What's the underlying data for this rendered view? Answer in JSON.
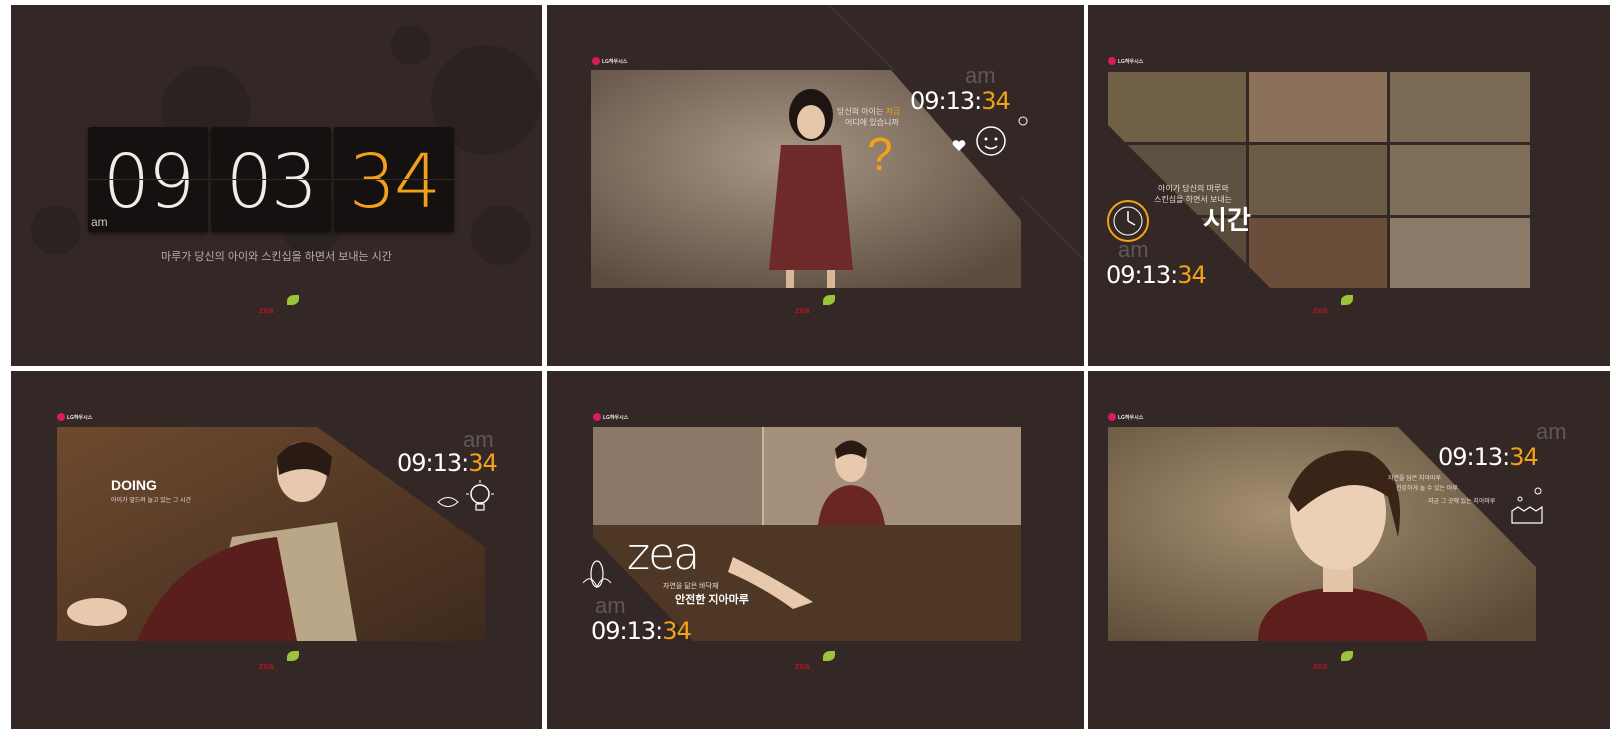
{
  "colors": {
    "panel_bg": "#332826",
    "accent": "#f2a119",
    "text": "#ffffff",
    "brand_red": "#b0141f",
    "logo_pink": "#d91a5b",
    "leaf_green": "#9bc43a"
  },
  "panel1": {
    "hours": "09",
    "minutes": "03",
    "seconds": "34",
    "ampm": "am",
    "caption": "마루가 당신의 아이와 스킨십을 하면서 보내는 시간",
    "brand": "zea"
  },
  "panel2": {
    "logo": "LG하우시스",
    "ampm": "am",
    "clock_hm": "09:13:",
    "clock_s": "34",
    "question_line1_a": "당신의 아이는 ",
    "question_line1_b": "지금",
    "question_line2": "어디에 있습니까",
    "question_mark": "?",
    "icons": [
      "child-face-icon",
      "heart-icon",
      "flower-icon"
    ],
    "brand": "zea"
  },
  "panel3": {
    "logo": "LG하우시스",
    "ampm": "am",
    "clock_hm": "09:13:",
    "clock_s": "34",
    "sub_line1": "아이가 당신의 마루와",
    "sub_line2": "스킨십을 하면서 보내는",
    "headline": "시간",
    "icons": [
      "clock-icon"
    ],
    "brand": "zea"
  },
  "panel4": {
    "logo": "LG하우시스",
    "ampm": "am",
    "clock_hm": "09:13:",
    "clock_s": "34",
    "headline": "DOING",
    "sub": "아이가 엎드려 놀고 있는 그 시간",
    "icons": [
      "lightbulb-icon",
      "leaf-icon"
    ],
    "brand": "zea"
  },
  "panel5": {
    "logo": "LG하우시스",
    "ampm": "am",
    "clock_hm": "09:13:",
    "clock_s": "34",
    "brand_big": "zea",
    "sub_line1": "자연을 닮은 바닥재",
    "headline": "안전한 지아마루",
    "icons": [
      "corn-icon"
    ],
    "brand": "zea"
  },
  "panel6": {
    "logo": "LG하우시스",
    "ampm": "am",
    "clock_hm": "09:13:",
    "clock_s": "34",
    "sub_line1": "자연을 담은 지아마루",
    "sub_line2": "건강하게 놀 수 있는 마루",
    "sub_line3": "지금 그 곳에 있는 지아마루",
    "icons": [
      "house-icon"
    ],
    "brand": "zea"
  }
}
